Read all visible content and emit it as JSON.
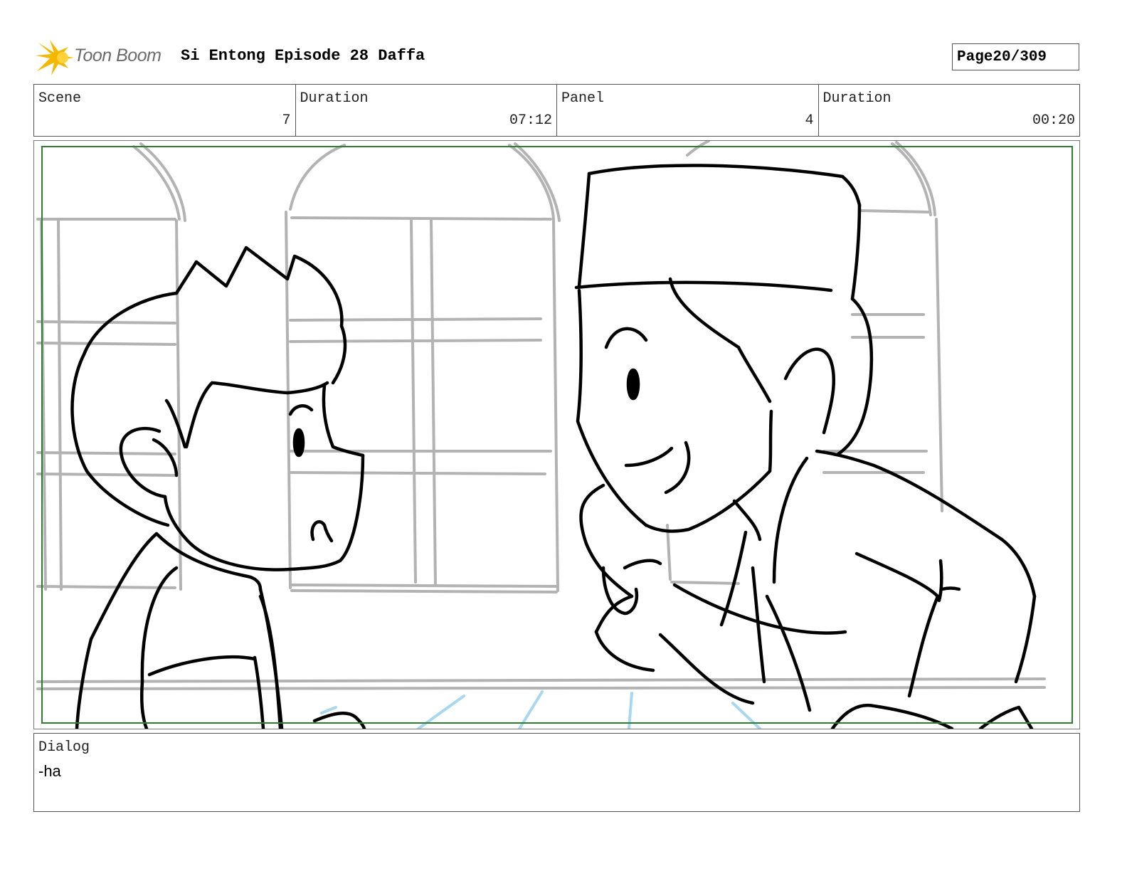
{
  "header": {
    "logo_text": "Toon Boom",
    "title": "Si Entong Episode 28 Daffa",
    "page_label": "Page",
    "page_value": "20/309"
  },
  "info": {
    "scene_label": "Scene",
    "scene_value": "7",
    "scene_duration_label": "Duration",
    "scene_duration_value": "07:12",
    "panel_label": "Panel",
    "panel_value": "4",
    "panel_duration_label": "Duration",
    "panel_duration_value": "00:20"
  },
  "dialog": {
    "label": "Dialog",
    "text": "-ha"
  },
  "colors": {
    "safe_frame": "#2e7d32",
    "sketch_background": "#b3b3b3",
    "sketch_lines": "#000000",
    "sketch_floor": "#a8d8ef",
    "logo_star": "#f5b800"
  }
}
